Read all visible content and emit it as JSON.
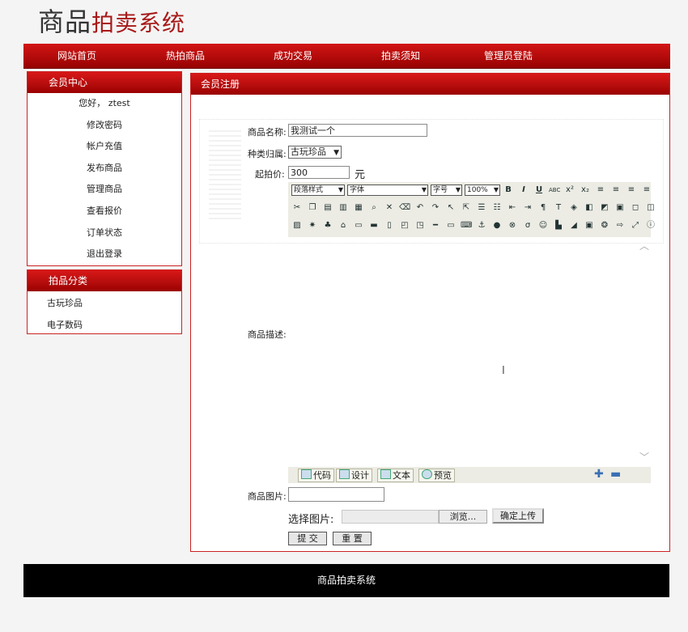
{
  "site": {
    "title_part1": "商品",
    "title_part2": "拍卖系统"
  },
  "nav": [
    "网站首页",
    "热拍商品",
    "成功交易",
    "拍卖须知",
    "管理员登陆"
  ],
  "member": {
    "title": "会员中心",
    "greeting": "您好，  ztest",
    "menu": [
      "修改密码",
      "帐户充值",
      "发布商品",
      "管理商品",
      "查看报价",
      "订单状态",
      "退出登录"
    ]
  },
  "category": {
    "title": "拍品分类",
    "items": [
      "古玩珍品",
      "电子数码"
    ]
  },
  "form": {
    "heading": "会员注册",
    "name_label": "商品名称:",
    "name_value": "我测试一个",
    "type_label": "种类归属:",
    "type_value": "古玩珍品",
    "price_label": "起拍价:",
    "price_value": "300",
    "price_unit": "元",
    "desc_label": "商品描述:",
    "image_label": "商品图片:",
    "choose_label": "选择图片:",
    "browse": "浏览...",
    "upload": "确定上传",
    "submit": "提 交",
    "reset": "重 置"
  },
  "editor": {
    "paragraph_style": "段落样式",
    "font": "字体",
    "font_size": "字号",
    "zoom": "100%",
    "modes": [
      "代码",
      "设计",
      "文本",
      "预览"
    ]
  },
  "footer": "商品拍卖系统"
}
